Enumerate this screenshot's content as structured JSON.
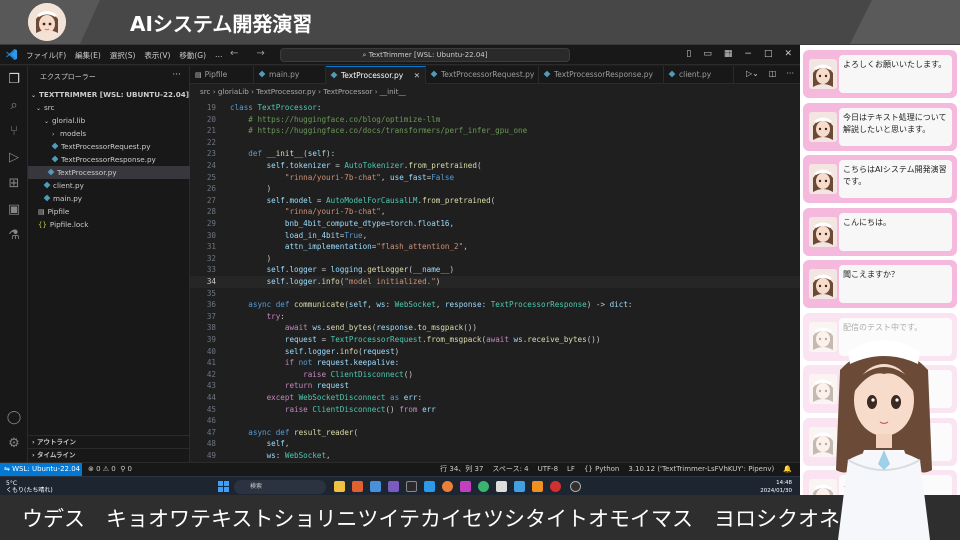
{
  "banner": {
    "title": "AIシステム開発演習"
  },
  "vscode": {
    "menu": [
      "ファイル(F)",
      "編集(E)",
      "選択(S)",
      "表示(V)",
      "移動(G)",
      "…"
    ],
    "command_center": "TextTrimmer [WSL: Ubuntu-22.04]",
    "sidebar": {
      "header": "エクスプローラー",
      "root": "TEXTTRIMMER [WSL: UBUNTU-22.04]",
      "items": [
        {
          "label": "src",
          "kind": "folder"
        },
        {
          "label": "glorial.lib",
          "kind": "folder"
        },
        {
          "label": "models",
          "kind": "folder"
        },
        {
          "label": "TextProcessorRequest.py",
          "kind": "py"
        },
        {
          "label": "TextProcessorResponse.py",
          "kind": "py"
        },
        {
          "label": "TextProcessor.py",
          "kind": "py"
        },
        {
          "label": "client.py",
          "kind": "py"
        },
        {
          "label": "main.py",
          "kind": "py"
        },
        {
          "label": "Pipfile",
          "kind": "file"
        },
        {
          "label": "Pipfile.lock",
          "kind": "json"
        }
      ],
      "footer": [
        "アウトライン",
        "タイムライン"
      ]
    },
    "tabs": [
      "Pipfile",
      "main.py",
      "TextProcessor.py",
      "TextProcessorRequest.py",
      "TextProcessorResponse.py",
      "client.py"
    ],
    "breadcrumbs": "src › gloriaLib › TextProcessor.py › TextProcessor › __init__",
    "code_lines": [
      {
        "n": "19",
        "t": "class TextProcessor:"
      },
      {
        "n": "20",
        "t": "    # https://huggingface.co/blog/optimize-llm"
      },
      {
        "n": "21",
        "t": "    # https://huggingface.co/docs/transformers/perf_infer_gpu_one"
      },
      {
        "n": "22",
        "t": ""
      },
      {
        "n": "23",
        "t": "    def __init__(self):"
      },
      {
        "n": "24",
        "t": "        self.tokenizer = AutoTokenizer.from_pretrained("
      },
      {
        "n": "25",
        "t": "            \"rinna/youri-7b-chat\", use_fast=False"
      },
      {
        "n": "26",
        "t": "        )"
      },
      {
        "n": "27",
        "t": "        self.model = AutoModelForCausalLM.from_pretrained("
      },
      {
        "n": "28",
        "t": "            \"rinna/youri-7b-chat\","
      },
      {
        "n": "29",
        "t": "            bnb_4bit_compute_dtype=torch.float16,"
      },
      {
        "n": "30",
        "t": "            load_in_4bit=True,"
      },
      {
        "n": "31",
        "t": "            attn_implementation=\"flash_attention_2\","
      },
      {
        "n": "32",
        "t": "        )"
      },
      {
        "n": "33",
        "t": "        self.logger = logging.getLogger(__name__)"
      },
      {
        "n": "34",
        "t": "        self.logger.info(\"model initialized.\")"
      },
      {
        "n": "35",
        "t": ""
      },
      {
        "n": "36",
        "t": "    async def communicate(self, ws: WebSocket, response: TextProcessorResponse) -> dict:"
      },
      {
        "n": "37",
        "t": "        try:"
      },
      {
        "n": "38",
        "t": "            await ws.send_bytes(response.to_msgpack())"
      },
      {
        "n": "39",
        "t": "            request = TextProcessorRequest.from_msgpack(await ws.receive_bytes())"
      },
      {
        "n": "40",
        "t": "            self.logger.info(request)"
      },
      {
        "n": "41",
        "t": "            if not request.keepalive:"
      },
      {
        "n": "42",
        "t": "                raise ClientDisconnect()"
      },
      {
        "n": "43",
        "t": "            return request"
      },
      {
        "n": "44",
        "t": "        except WebSocketDisconnect as err:"
      },
      {
        "n": "45",
        "t": "            raise ClientDisconnect() from err"
      },
      {
        "n": "46",
        "t": ""
      },
      {
        "n": "47",
        "t": "    async def result_reader("
      },
      {
        "n": "48",
        "t": "        self,"
      },
      {
        "n": "49",
        "t": "        ws: WebSocket,"
      },
      {
        "n": "50",
        "t": "        communicate_id: str,"
      }
    ],
    "status": {
      "remote": "WSL: Ubuntu-22.04",
      "problems": "⊗ 0 ⚠ 0",
      "ports": "⚲ 0",
      "right": [
        "行 34、列 37",
        "スペース: 4",
        "UTF-8",
        "LF",
        "{} Python",
        "3.10.12 ('TextTrimmer-LsFVhKUY': Pipenv)",
        "🔔"
      ]
    }
  },
  "taskbar": {
    "weather_line1": "5°C",
    "weather_line2": "くもり(たち晴れ)",
    "search": "検索",
    "time": "14:48",
    "date": "2024/01/30"
  },
  "chat": {
    "messages": [
      {
        "text": "よろしくお願いいたします。"
      },
      {
        "text": "今日はテキスト処理について解説したいと思います。"
      },
      {
        "text": "こちらはAIシステム開発演習です。"
      },
      {
        "text": "こんにちは。"
      },
      {
        "text": "聞こえますか？"
      },
      {
        "text": "配信のテスト中です。"
      },
      {
        "text": ""
      },
      {
        "text": "音"
      },
      {
        "text": "…接続"
      }
    ]
  },
  "subtitle": {
    "text": "ウデス　キョオワテキストショリニツイテカイセツシタイトオモイマス　ヨロシクオネガ"
  },
  "colors": {
    "accent": "#0078d4",
    "chat_bubble": "#f4b9dc",
    "banner": "#474747"
  }
}
